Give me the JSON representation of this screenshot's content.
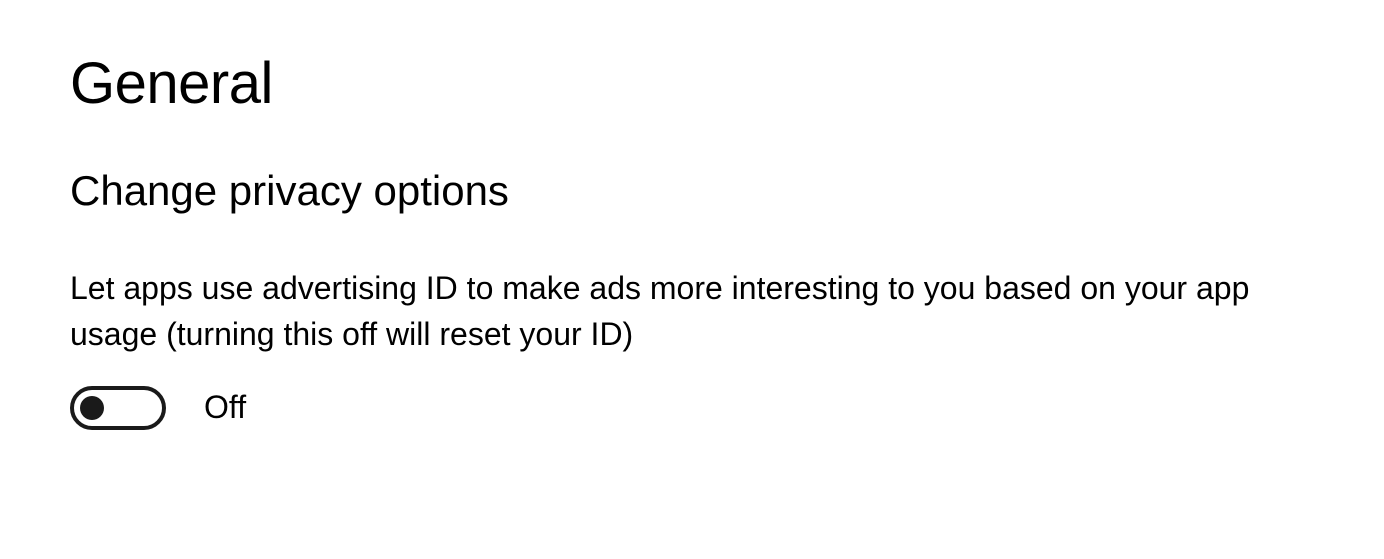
{
  "page": {
    "title": "General",
    "section_heading": "Change privacy options"
  },
  "settings": {
    "advertising_id": {
      "description": "Let apps use advertising ID to make ads more interesting to you based on your app usage (turning this off will reset your ID)",
      "state_label": "Off",
      "is_on": false
    }
  }
}
